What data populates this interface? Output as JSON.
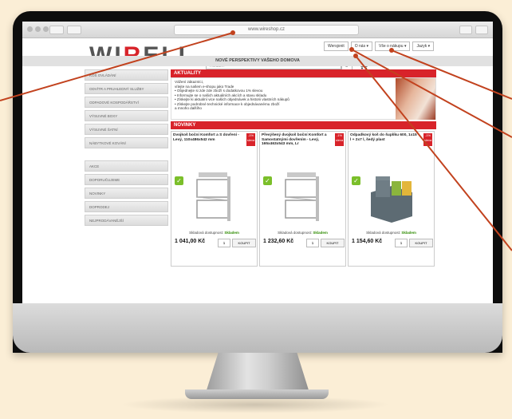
{
  "browser": {
    "url": "www.wireshop.cz"
  },
  "logo": {
    "text_a": "WI",
    "text_b": "R",
    "text_c": "ELI"
  },
  "header": {
    "tabs": [
      "Wersjonit",
      "O nás ▾",
      "Vše o nákupu ▾",
      "Jazyk ▾"
    ],
    "search_placeholder": "Hledat...",
    "search_icon": "search-icon",
    "cart_text": "Košík: 0,00 Kč s DPH"
  },
  "banner": "NOVÉ PERSPEKTIVY VAŠEHO DOMOVA",
  "sidebar": {
    "items": [
      "KOŠ OVLÁDÁNÍ",
      "ODVÍTR A PRUHLEDNÝ SLUŽBY",
      "ODPADOVÉ KOSPODÁŘSTVÍ",
      "VÝSUVNÉ BOXY",
      "VÝSUVNÉ ŠATNÍ",
      "NÁBYTKOVÉ KOVÁNÍ"
    ],
    "items2": [
      "AKCE",
      "DOPORUČUJEME",
      "NOVINKY",
      "DOPRODEJ",
      "NEJPRODÁVANĚJŠÍ"
    ]
  },
  "news": {
    "title": "AKTUALITY",
    "lines": [
      "Vážení zákazníci,",
      "vítejte na našem e-shopu jako Trade",
      "• Objednejte si zde zde zboží s dodatkovou 1% slevou",
      "• Informujte se o našich aktuálních akcích a stavu skladu",
      "• Získejte ki aktuální vice našich objednávek a historii vlastních nákupů",
      "• Získejte podrobné technické informace k objednávanému zboží",
      "   a mnoho dalšího"
    ]
  },
  "novinky_title": "NOVINKY",
  "products": [
    {
      "name": "Dvojkoš boční Komfort a S dovření - Levý, 110x486x542 mm",
      "badge": "-1% sleva",
      "avail_label": "Skladová dostupnost:",
      "avail": "Skladem",
      "price": "1 041,00 Kč",
      "qty": "1",
      "buy": "KOUPIT"
    },
    {
      "name": "Převýšený dvojkoš boční Komfort a Samostatnými dovřením - Levý, 165x463x543 mm, Lr",
      "badge": "-1% sleva",
      "avail_label": "Skladová dostupnost:",
      "avail": "Skladem",
      "price": "1 232,60 Kč",
      "qty": "1",
      "buy": "KOUPIT"
    },
    {
      "name": "Odpadkový koš do šuplíku 600, 1x15 l + 2x7 l, šedý plast",
      "badge": "-1% sleva",
      "avail_label": "Skladová dostupnost:",
      "avail": "Skladem",
      "price": "1 154,60 Kč",
      "qty": "1",
      "buy": "KOUPIT"
    }
  ]
}
